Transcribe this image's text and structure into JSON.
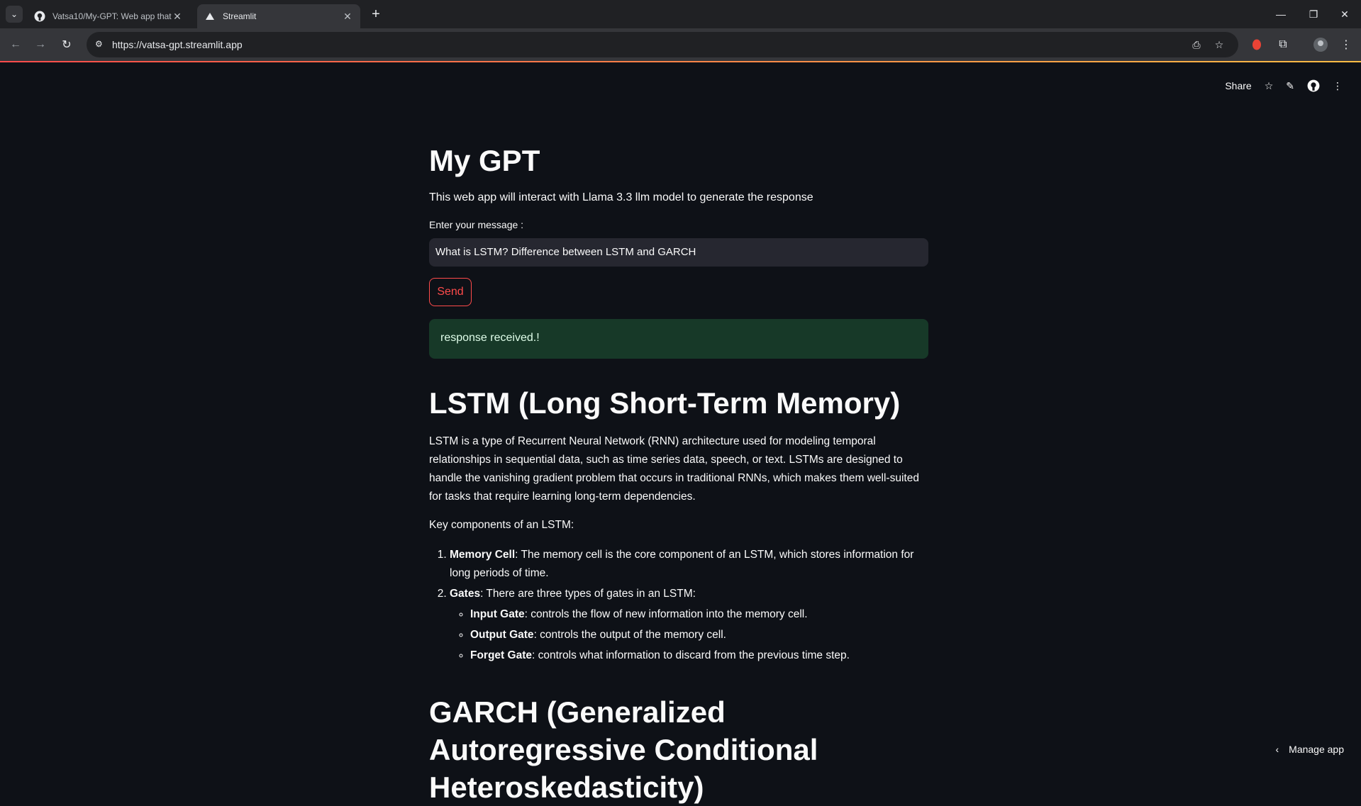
{
  "browser": {
    "tabs": [
      {
        "title": "Vatsa10/My-GPT: Web app that",
        "favicon": "github-icon",
        "active": false
      },
      {
        "title": "Streamlit",
        "favicon": "streamlit-icon",
        "active": true
      }
    ],
    "url": "https://vatsa-gpt.streamlit.app"
  },
  "header": {
    "share_label": "Share"
  },
  "app": {
    "title": "My GPT",
    "subtitle": "This web app will interact with Llama 3.3 llm model to generate the response",
    "input_label": "Enter your message :",
    "input_value": "What is LSTM? Difference between LSTM and GARCH",
    "send_label": "Send",
    "success_message": "response received.!"
  },
  "response": {
    "lstm_heading": "LSTM (Long Short-Term Memory)",
    "lstm_paragraph": "LSTM is a type of Recurrent Neural Network (RNN) architecture used for modeling temporal relationships in sequential data, such as time series data, speech, or text. LSTMs are designed to handle the vanishing gradient problem that occurs in traditional RNNs, which makes them well-suited for tasks that require learning long-term dependencies.",
    "key_components_intro": "Key components of an LSTM:",
    "components": [
      {
        "term": "Memory Cell",
        "text": ": The memory cell is the core component of an LSTM, which stores information for long periods of time."
      },
      {
        "term": "Gates",
        "text": ": There are three types of gates in an LSTM:"
      }
    ],
    "gates": [
      {
        "term": "Input Gate",
        "text": ": controls the flow of new information into the memory cell."
      },
      {
        "term": "Output Gate",
        "text": ": controls the output of the memory cell."
      },
      {
        "term": "Forget Gate",
        "text": ": controls what information to discard from the previous time step."
      }
    ],
    "garch_heading": "GARCH (Generalized Autoregressive Conditional Heteroskedasticity)"
  },
  "footer": {
    "manage_label": "Manage app"
  }
}
